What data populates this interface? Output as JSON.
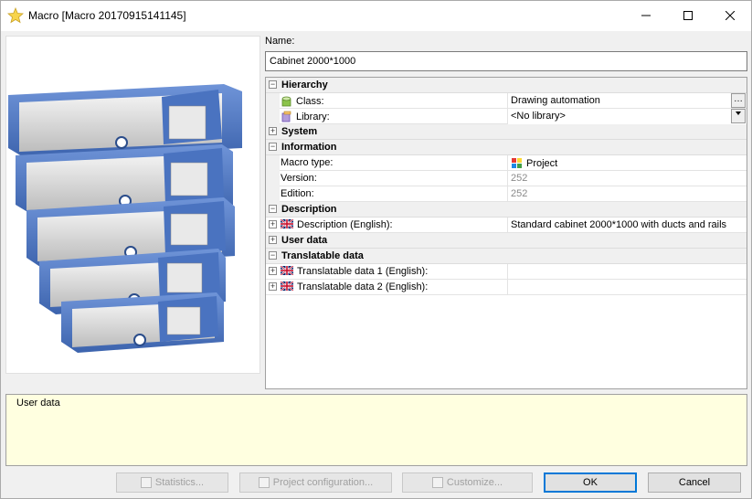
{
  "window": {
    "title": "Macro [Macro 20170915141145]"
  },
  "name": {
    "label": "Name:",
    "value": "Cabinet 2000*1000"
  },
  "grid": {
    "hierarchy": {
      "label": "Hierarchy",
      "class_label": "Class:",
      "class_value": "Drawing automation",
      "library_label": "Library:",
      "library_value": "<No library>"
    },
    "system": {
      "label": "System"
    },
    "information": {
      "label": "Information",
      "macro_type_label": "Macro type:",
      "macro_type_value": "Project",
      "version_label": "Version:",
      "version_value": "252",
      "edition_label": "Edition:",
      "edition_value": "252"
    },
    "description": {
      "label": "Description",
      "desc_label": "Description (English):",
      "desc_value": "Standard cabinet 2000*1000 with ducts and rails"
    },
    "user_data": {
      "label": "User data"
    },
    "translatable": {
      "label": "Translatable data",
      "item1_label": "Translatable data 1 (English):",
      "item1_value": "",
      "item2_label": "Translatable data 2 (English):",
      "item2_value": ""
    }
  },
  "description_pane": {
    "text": "User data"
  },
  "buttons": {
    "statistics": "Statistics...",
    "project_configuration": "Project configuration...",
    "customize": "Customize...",
    "ok": "OK",
    "cancel": "Cancel"
  },
  "icons": {
    "title": "star-icon",
    "class": "class-icon",
    "library": "library-icon",
    "macro_type": "project-icon",
    "flag": "uk-flag-icon"
  },
  "colors": {
    "description_pane_bg": "#ffffe0",
    "default_button_border": "#0078d7",
    "binder_blue": "#4a73c0"
  }
}
